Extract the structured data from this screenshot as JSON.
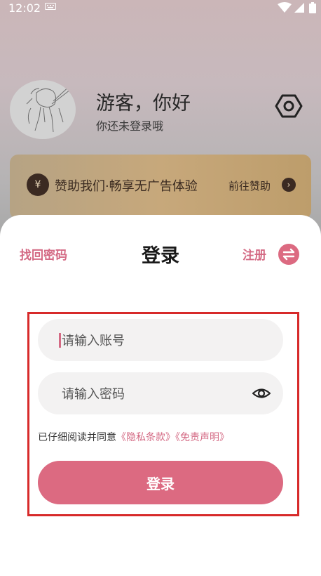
{
  "status_bar": {
    "time": "12:02",
    "icons": [
      "keyboard-icon",
      "wifi-icon",
      "signal-icon",
      "battery-icon"
    ]
  },
  "profile": {
    "greeting": "游客，你好",
    "subtitle": "你还未登录哦"
  },
  "sponsor": {
    "badge": "¥",
    "text": "赞助我们·畅享无广告体验",
    "link": "前往赞助",
    "arrow": "›"
  },
  "login_sheet": {
    "find_password": "找回密码",
    "title": "登录",
    "register": "注册",
    "account_placeholder": "请输入账号",
    "password_placeholder": "请输入密码",
    "agreement_prefix": "已仔细阅读并同意",
    "privacy_link": "《隐私条款》",
    "disclaimer_link": "《免责声明》",
    "login_button": "登录"
  },
  "colors": {
    "accent": "#dc6a81",
    "link": "#d46a84",
    "highlight": "#d72a2a"
  }
}
